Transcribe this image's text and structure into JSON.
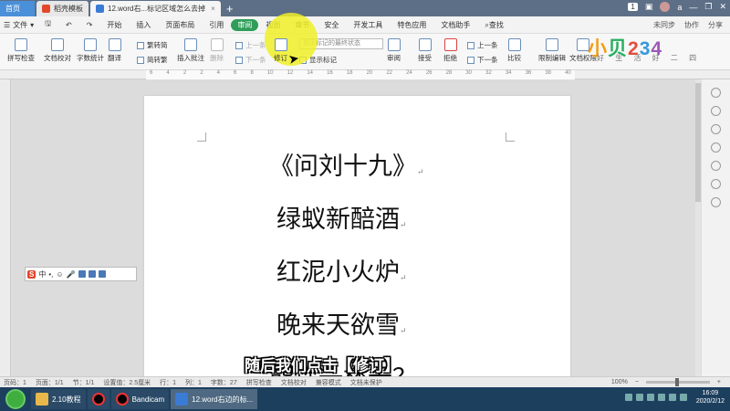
{
  "tabs": {
    "home": "首页",
    "template": "稻壳模板",
    "doc": "12.word右...标记区域怎么去掉"
  },
  "window": {
    "count": "1"
  },
  "menu": {
    "file": "文件",
    "items": [
      "开始",
      "插入",
      "页面布局",
      "引用",
      "审阅",
      "视图",
      "章节",
      "安全",
      "开发工具",
      "特色应用",
      "文档助手"
    ],
    "search": "查找",
    "sync": "未同步",
    "collab": "协作",
    "share": "分享"
  },
  "ribbon": {
    "spellcheck": "拼写检查",
    "doc_proof": "文档校对",
    "word_count": "字数统计",
    "translate": "翻译",
    "to_traditional": "繁转简",
    "to_simplified": "简转繁",
    "insert_comment": "插入批注",
    "delete": "删除",
    "prev": "上一条",
    "next": "下一条",
    "track_changes": "修订",
    "show_markup": "显示标记",
    "markup_state": "显示标记的最终状态",
    "review": "审阅",
    "accept": "接受",
    "reject": "拒绝",
    "prev2": "上一条",
    "next2": "下一条",
    "compare": "比较",
    "restrict": "限制编辑",
    "doc_permission": "文档权限"
  },
  "logo": {
    "text": "小贝234",
    "sub": "好 生 活 好 二 四"
  },
  "poem": {
    "title": "《问刘十九》",
    "lines": [
      "绿蚁新醅酒",
      "红泥小火炉",
      "晚来天欲雪",
      "能饮一杯无？"
    ]
  },
  "subtitle": "随后我们点击【修订】",
  "status": {
    "page": "页码：1",
    "pages": "页面：1/1",
    "section": "节：1/1",
    "setting": "设置值：2.5厘米",
    "row": "行：1",
    "col": "列：1",
    "wordcount": "字数：27",
    "spell": "拼写检查",
    "proof": "文档校对",
    "mode": "兼容模式",
    "protect": "文档未保护",
    "zoom": "100%"
  },
  "taskbar": {
    "folder": "2.10教程",
    "bandicam": "Bandicam",
    "wps": "12.word右边的标...",
    "time": "16:09",
    "date": "2020/2/12"
  },
  "ime": {
    "label": "中"
  },
  "colors": {
    "accent": "#2e9e58",
    "highlight": "#eeee28",
    "tabbar": "#5d6f86",
    "taskbar": "#1d3f5e"
  }
}
